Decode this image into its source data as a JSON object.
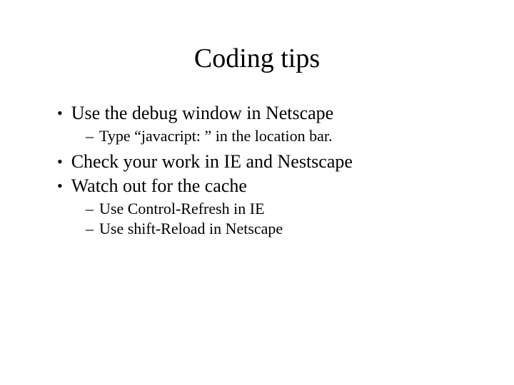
{
  "title": "Coding tips",
  "bullets": {
    "b1": "Use the debug window in Netscape",
    "b1_1": "Type “javacript: ” in the location bar.",
    "b2": "Check your work in IE and Nestscape",
    "b3": "Watch out for the cache",
    "b3_1": "Use Control-Refresh in IE",
    "b3_2": "Use shift-Reload in Netscape"
  }
}
